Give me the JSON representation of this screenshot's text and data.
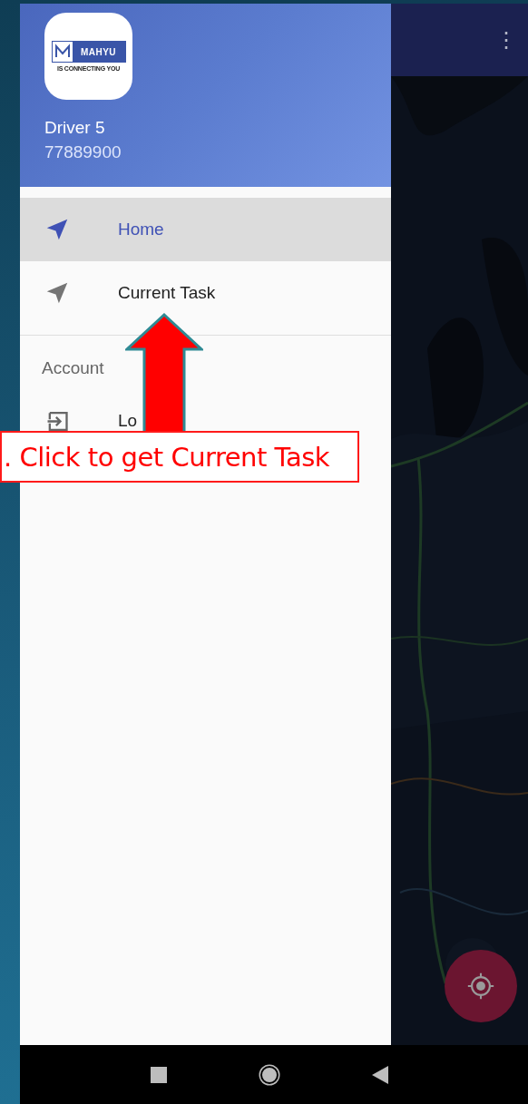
{
  "top_bar": {
    "menu": "⋮"
  },
  "drawer": {
    "logo": {
      "brand": "MAHYU",
      "tagline": "IS CONNECTING YOU"
    },
    "user_name": "Driver 5",
    "phone": "77889900",
    "items": [
      {
        "label": "Home",
        "selected": true
      },
      {
        "label": "Current Task",
        "selected": false
      }
    ],
    "section": "Account",
    "account_item": {
      "label": "Lo"
    }
  },
  "annotation": {
    "text": ". Click to get Current Task"
  }
}
